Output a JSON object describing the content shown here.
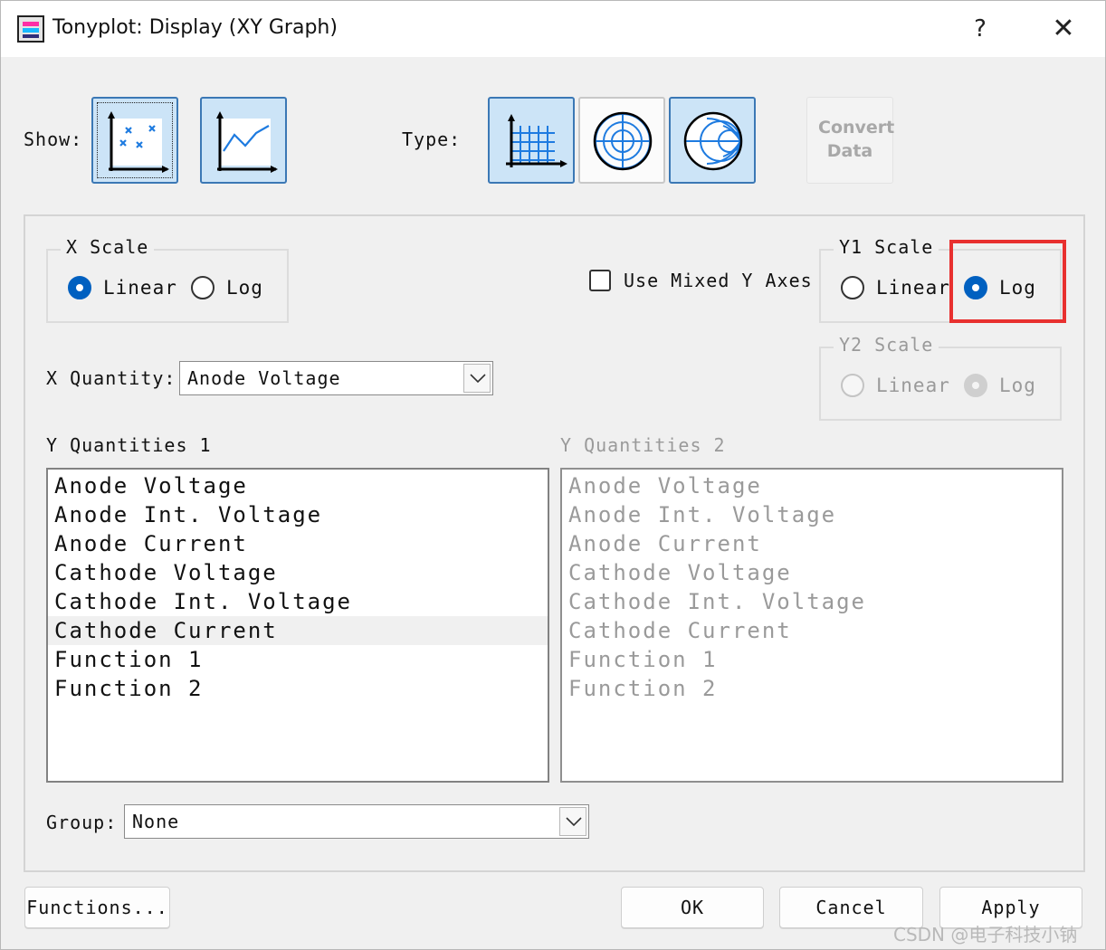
{
  "window": {
    "title": "Tonyplot: Display (XY Graph)",
    "help_label": "?",
    "close_label": "✕"
  },
  "toolbar": {
    "show_label": "Show:",
    "type_label": "Type:",
    "show_buttons": [
      {
        "icon": "scatter-plot-icon",
        "state": "selected"
      },
      {
        "icon": "line-plot-icon",
        "state": "selected"
      }
    ],
    "type_buttons": [
      {
        "icon": "cartesian-grid-icon",
        "state": "selected"
      },
      {
        "icon": "polar-grid-icon",
        "state": "normal"
      },
      {
        "icon": "smith-chart-icon",
        "state": "selected"
      }
    ],
    "convert_data_label": "Convert Data"
  },
  "x_scale": {
    "title": "X Scale",
    "options": [
      "Linear",
      "Log"
    ],
    "selected": "Linear"
  },
  "mixed_axes": {
    "label": "Use Mixed Y Axes",
    "checked": false
  },
  "y1_scale": {
    "title": "Y1 Scale",
    "options": [
      "Linear",
      "Log"
    ],
    "selected": "Log"
  },
  "y2_scale": {
    "title": "Y2 Scale",
    "options": [
      "Linear",
      "Log"
    ],
    "selected": "Log",
    "enabled": false
  },
  "x_quantity": {
    "label": "X Quantity:",
    "value": "Anode Voltage"
  },
  "y_quantities_1": {
    "label": "Y Quantities 1",
    "items": [
      "Anode Voltage",
      "Anode Int. Voltage",
      "Anode Current",
      "Cathode Voltage",
      "Cathode Int. Voltage",
      "Cathode Current",
      "Function 1",
      "Function 2"
    ],
    "selected_index": 5
  },
  "y_quantities_2": {
    "label": "Y Quantities 2",
    "items": [
      "Anode Voltage",
      "Anode Int. Voltage",
      "Anode Current",
      "Cathode Voltage",
      "Cathode Int. Voltage",
      "Cathode Current",
      "Function 1",
      "Function 2"
    ],
    "enabled": false
  },
  "group": {
    "label": "Group:",
    "value": "None"
  },
  "buttons": {
    "functions": "Functions...",
    "ok": "OK",
    "cancel": "Cancel",
    "apply": "Apply"
  },
  "watermark": "CSDN @电子科技小钠",
  "colors": {
    "selected_button_fill": "#cce4f7",
    "selected_button_border": "#3b78b5",
    "radio_checked": "#0060c0",
    "highlight_box": "#e8302f",
    "icon_blue": "#1e7be0"
  }
}
